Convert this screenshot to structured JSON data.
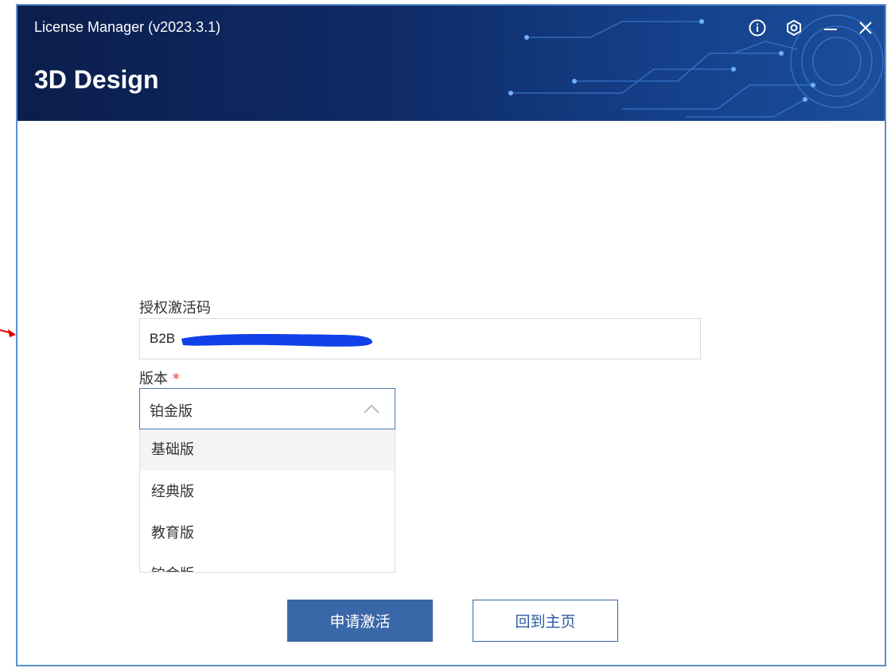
{
  "window": {
    "title": "License Manager (v2023.3.1)",
    "product": "3D Design",
    "controls": [
      "info-icon",
      "settings-icon",
      "minimize-icon",
      "close-icon"
    ]
  },
  "form": {
    "code_label": "授权激活码",
    "code_value": "B2B",
    "edition_label": "版本",
    "edition_required_mark": "*",
    "edition_selected": "铂金版",
    "edition_options": [
      "基础版",
      "经典版",
      "教育版",
      "铂金版"
    ]
  },
  "buttons": {
    "apply": "申请激活",
    "home": "回到主页"
  },
  "colors": {
    "header": "#0f2c68",
    "primary": "#3a67a8",
    "required": "#e03a3a"
  }
}
